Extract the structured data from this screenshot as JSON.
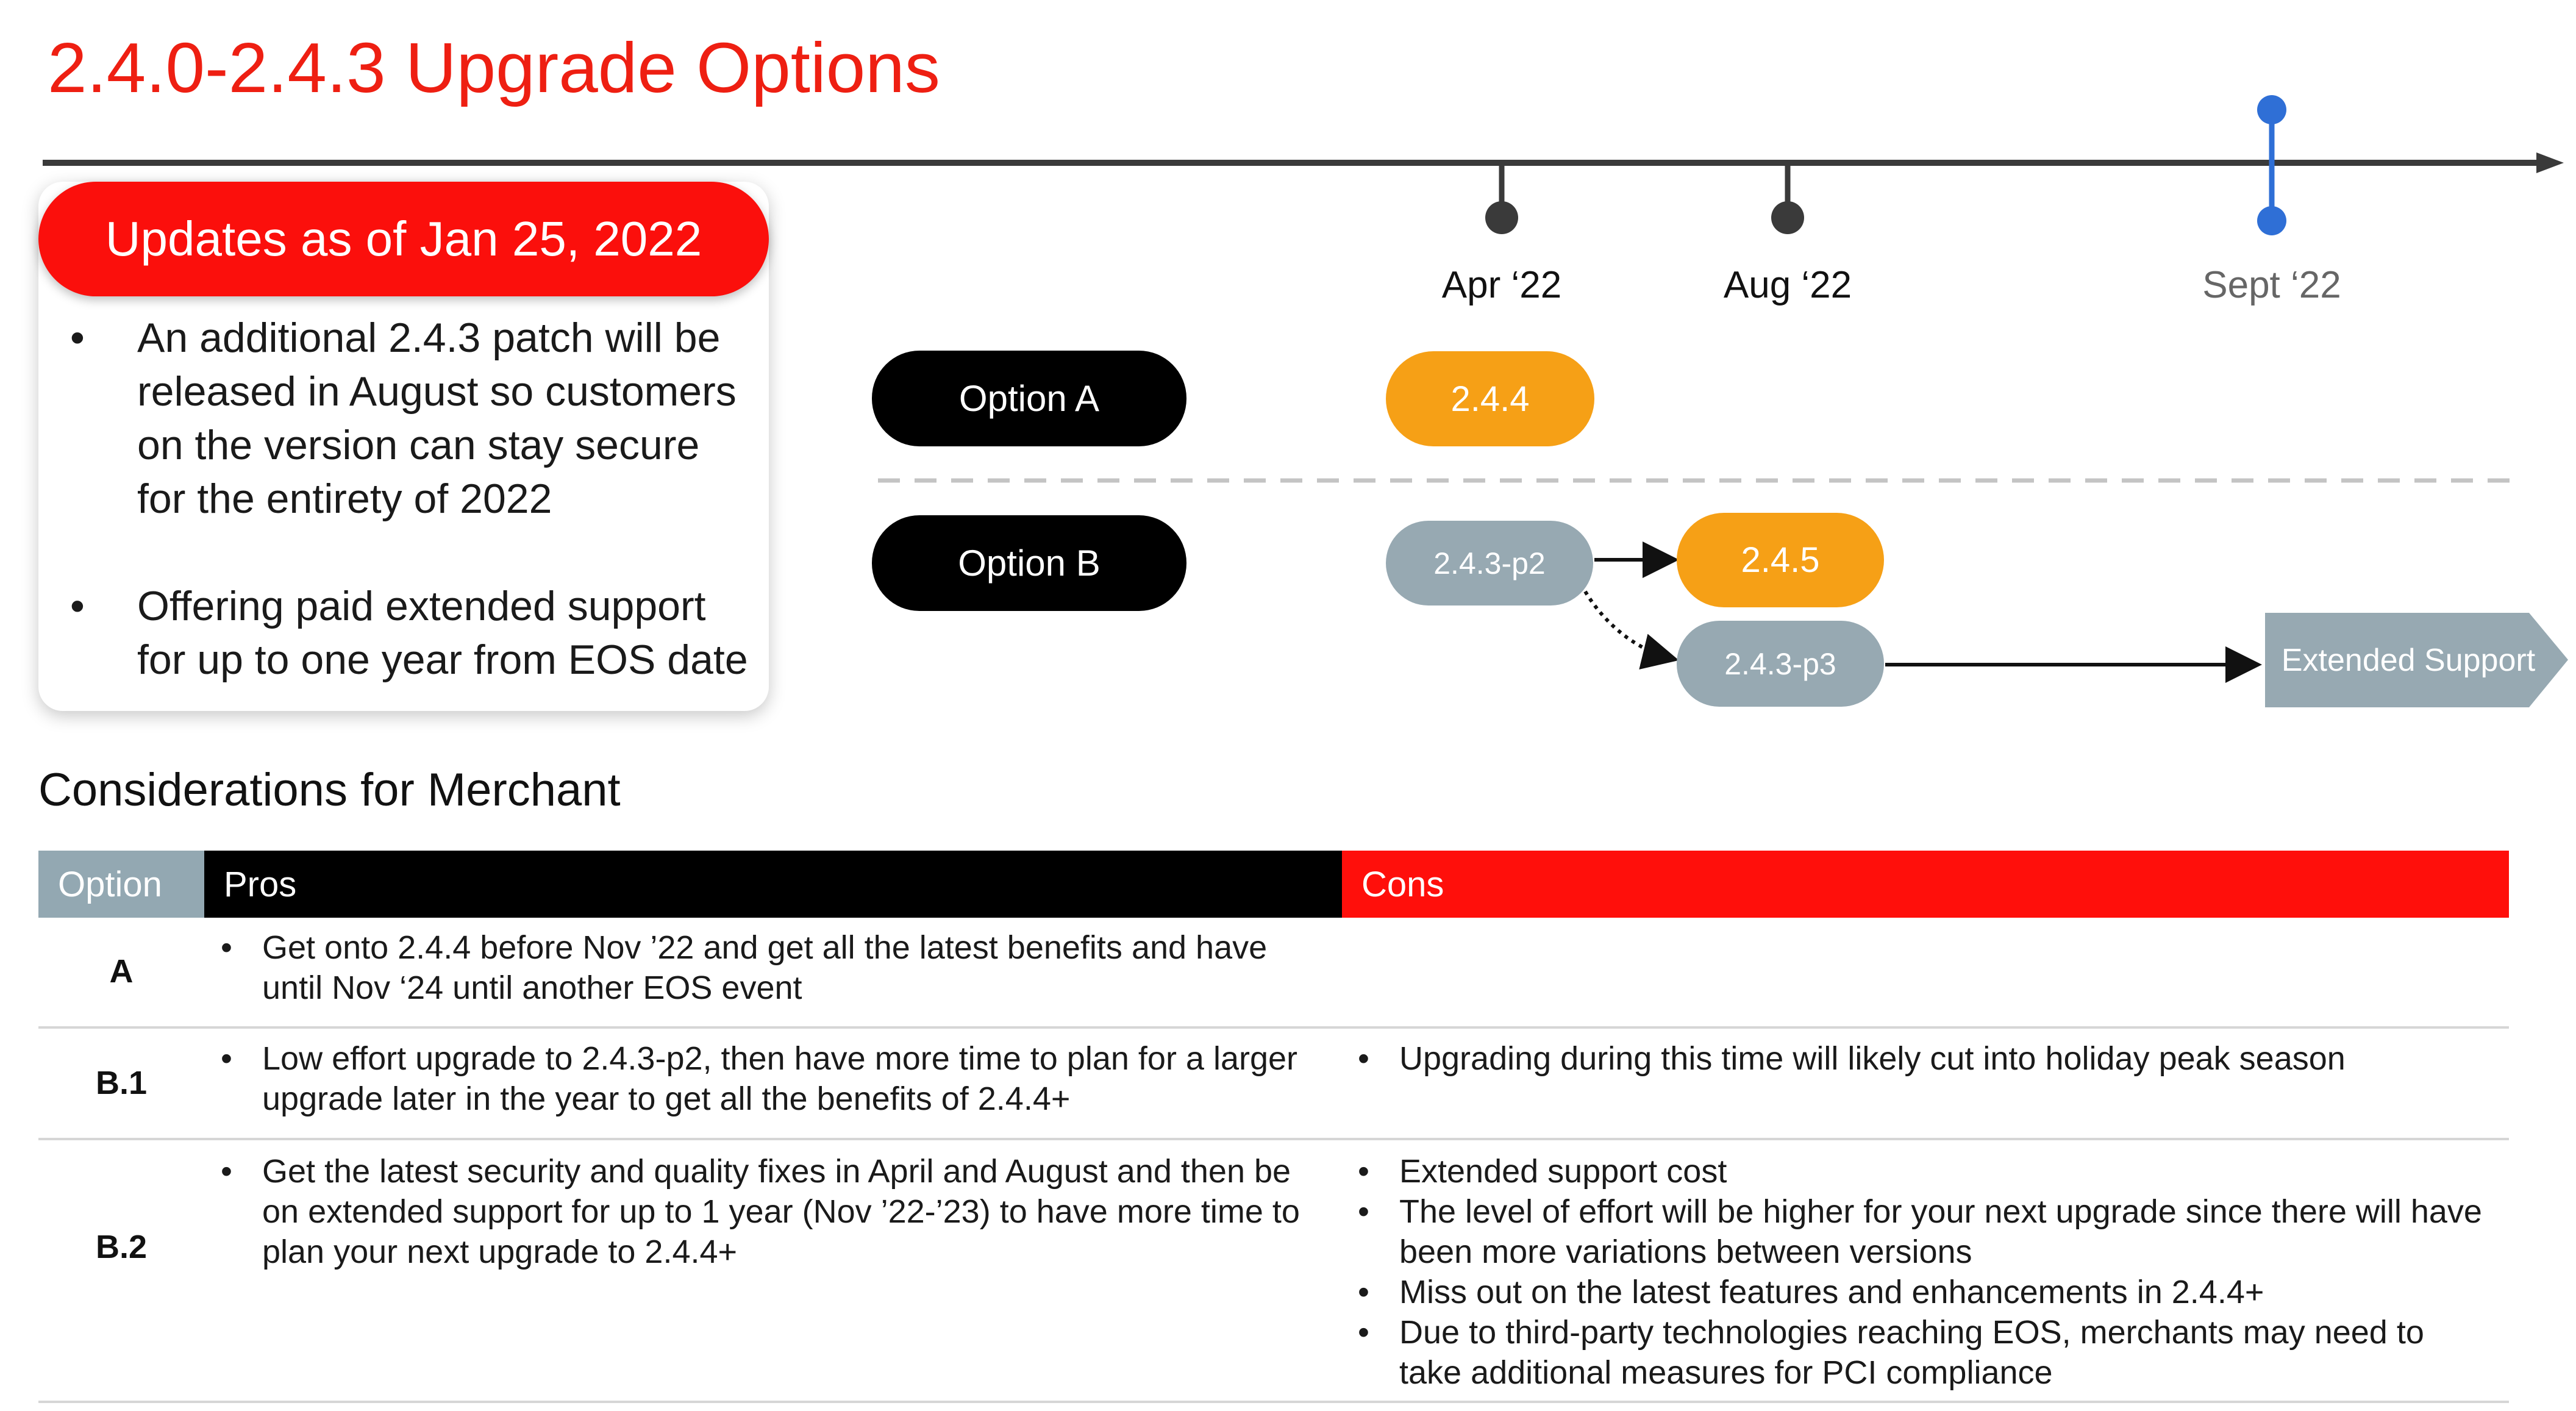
{
  "title": "2.4.0-2.4.3 Upgrade Options",
  "updates": {
    "header": "Updates as of Jan 25, 2022",
    "bullets": [
      "An additional 2.4.3 patch will be released in August so customers on the version can stay secure for the entirety of 2022",
      "Offering paid extended support for up to one year from EOS date"
    ]
  },
  "timeline": {
    "months": [
      "Apr ‘22",
      "Aug ‘22",
      "Sept ‘22"
    ],
    "colors": {
      "line": "#3a3a3a",
      "highlight": "#2f6fd6"
    }
  },
  "options": {
    "a": {
      "label": "Option A",
      "versions": [
        "2.4.4"
      ]
    },
    "b": {
      "label": "Option B",
      "versions": [
        "2.4.3-p2",
        "2.4.5",
        "2.4.3-p3"
      ],
      "extended": "Extended Support"
    }
  },
  "considerations": {
    "title": "Considerations for Merchant",
    "headers": {
      "option": "Option",
      "pros": "Pros",
      "cons": "Cons"
    },
    "rows": [
      {
        "option": "A",
        "pros": [
          "Get onto 2.4.4 before Nov ’22 and get all the latest benefits and have until Nov ‘24 until another EOS event"
        ],
        "cons": []
      },
      {
        "option": "B.1",
        "pros": [
          "Low effort upgrade to 2.4.3-p2, then have more time to plan for a larger upgrade later in the year to get all the benefits of 2.4.4+"
        ],
        "cons": [
          "Upgrading during this time will likely cut into holiday peak season"
        ]
      },
      {
        "option": "B.2",
        "pros": [
          "Get the latest security and quality fixes in April and August and then be on extended support for up to 1 year (Nov ’22-’23) to have more time to plan your next upgrade to 2.4.4+"
        ],
        "cons": [
          "Extended support cost",
          "The level of effort will be higher for your next upgrade since there will have been more variations between versions",
          "Miss out on the latest features and enhancements in 2.4.4+",
          "Due to third-party technologies reaching EOS, merchants may need to take additional measures for PCI compliance"
        ]
      }
    ]
  },
  "colors": {
    "brand_red": "#fb0f0c",
    "orange": "#f6a016",
    "grey_blue": "#97a9b2",
    "black": "#000000"
  }
}
